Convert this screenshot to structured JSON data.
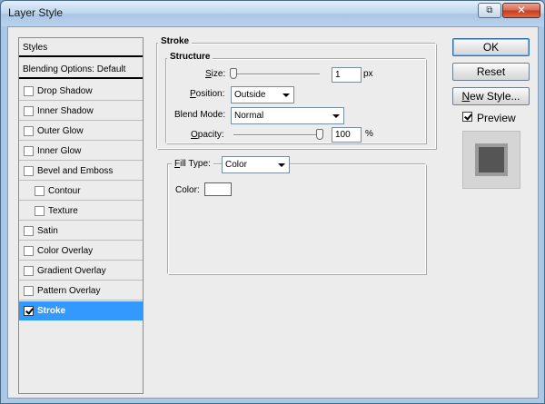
{
  "window": {
    "title": "Layer Style",
    "restore_glyph": "⧉",
    "close_glyph": "✕"
  },
  "styles_panel": {
    "header": "Styles",
    "blending": "Blending Options: Default",
    "items": [
      {
        "label": "Drop Shadow",
        "checked": false
      },
      {
        "label": "Inner Shadow",
        "checked": false
      },
      {
        "label": "Outer Glow",
        "checked": false
      },
      {
        "label": "Inner Glow",
        "checked": false
      },
      {
        "label": "Bevel and Emboss",
        "checked": false
      },
      {
        "label": "Contour",
        "checked": false
      },
      {
        "label": "Texture",
        "checked": false
      },
      {
        "label": "Satin",
        "checked": false
      },
      {
        "label": "Color Overlay",
        "checked": false
      },
      {
        "label": "Gradient Overlay",
        "checked": false
      },
      {
        "label": "Pattern Overlay",
        "checked": false
      },
      {
        "label": "Stroke",
        "checked": true
      }
    ]
  },
  "stroke": {
    "title": "Stroke",
    "structure_title": "Structure",
    "size": {
      "label_u": "S",
      "label_rest": "ize:",
      "value": "1",
      "unit": "px"
    },
    "position": {
      "label_u": "P",
      "label_rest": "osition:",
      "value": "Outside"
    },
    "blend_mode": {
      "label_pre": "Blend Mode",
      "label_u": "",
      "label_rest": ":",
      "value": "Normal"
    },
    "opacity": {
      "label_u": "O",
      "label_rest": "pacity:",
      "value": "100",
      "unit": "%"
    },
    "fill_type": {
      "label_u": "F",
      "label_rest": "ill Type:",
      "value": "Color"
    },
    "color": {
      "label": "Color:",
      "value": "#ffffff"
    }
  },
  "buttons": {
    "ok": "OK",
    "reset": "Reset",
    "new_style_u": "N",
    "new_style_rest": "ew Style...",
    "preview_label": "Preview",
    "preview_checked": true
  },
  "colors": {
    "selection": "#3399ff",
    "preview_fill": "#555555"
  }
}
